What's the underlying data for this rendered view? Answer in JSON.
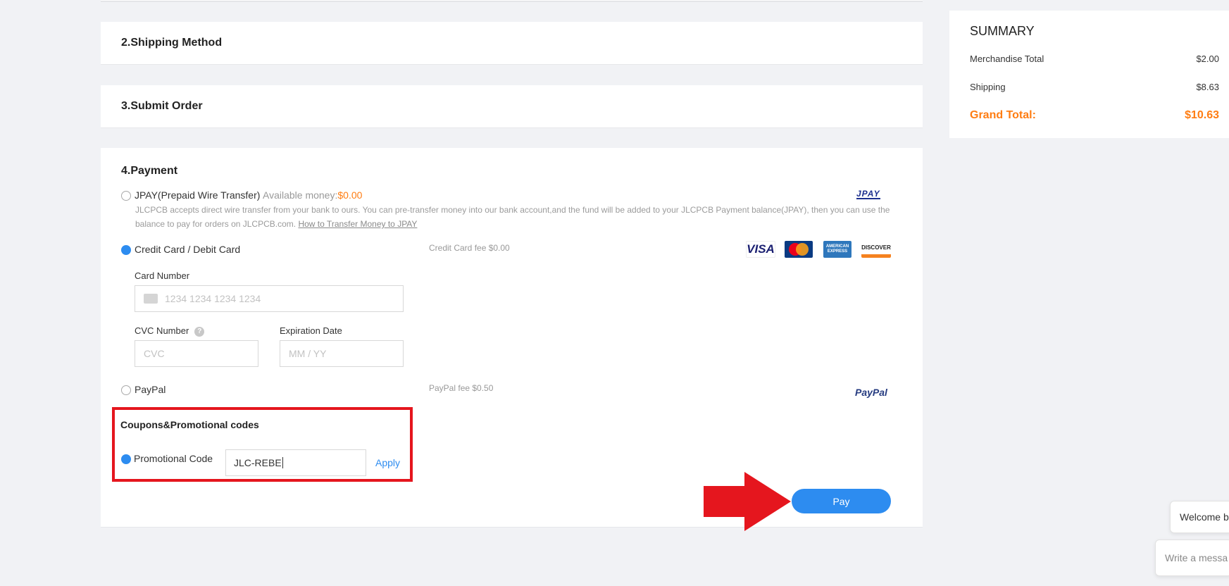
{
  "steps": {
    "shipping_method": "2.Shipping Method",
    "submit_order": "3.Submit Order"
  },
  "payment": {
    "title": "4.Payment",
    "jpay": {
      "label": "JPAY(Prepaid Wire Transfer)",
      "available_label": "Available money:",
      "available_value": "$0.00",
      "logo_text": "JPAY",
      "description": "JLCPCB accepts direct wire transfer from your bank to ours. You can pre-transfer money into our bank account,and the fund will be added to your JLCPCB Payment balance(JPAY), then you can use the balance to pay for orders on JLCPCB.com.",
      "link": "How to Transfer Money to JPAY"
    },
    "credit_card": {
      "label": "Credit Card / Debit Card",
      "fee": "Credit Card fee $0.00",
      "card_number_label": "Card Number",
      "card_number_placeholder": "1234 1234 1234 1234",
      "cvc_label": "CVC Number",
      "cvc_placeholder": "CVC",
      "expiry_label": "Expiration Date",
      "expiry_placeholder": "MM / YY",
      "logos": [
        "VISA",
        "MasterCard",
        "AMERICAN EXPRESS",
        "DISCOVER"
      ]
    },
    "paypal": {
      "label": "PayPal",
      "fee": "PayPal fee $0.50",
      "logo_text": "PayPal"
    },
    "coupons": {
      "title": "Coupons&Promotional codes",
      "option_label": "Promotional Code",
      "value": "JLC-REBE",
      "apply_label": "Apply"
    },
    "pay_button": "Pay"
  },
  "summary": {
    "title": "SUMMARY",
    "merchandise_label": "Merchandise Total",
    "merchandise_value": "$2.00",
    "shipping_label": "Shipping",
    "shipping_value": "$8.63",
    "grand_label": "Grand Total:",
    "grand_value": "$10.63"
  },
  "chat": {
    "welcome": "Welcome b",
    "input_placeholder": "Write a messa"
  },
  "colors": {
    "accent": "#2d8cf0",
    "orange": "#ff7d12",
    "annotation_red": "#e5161e"
  }
}
